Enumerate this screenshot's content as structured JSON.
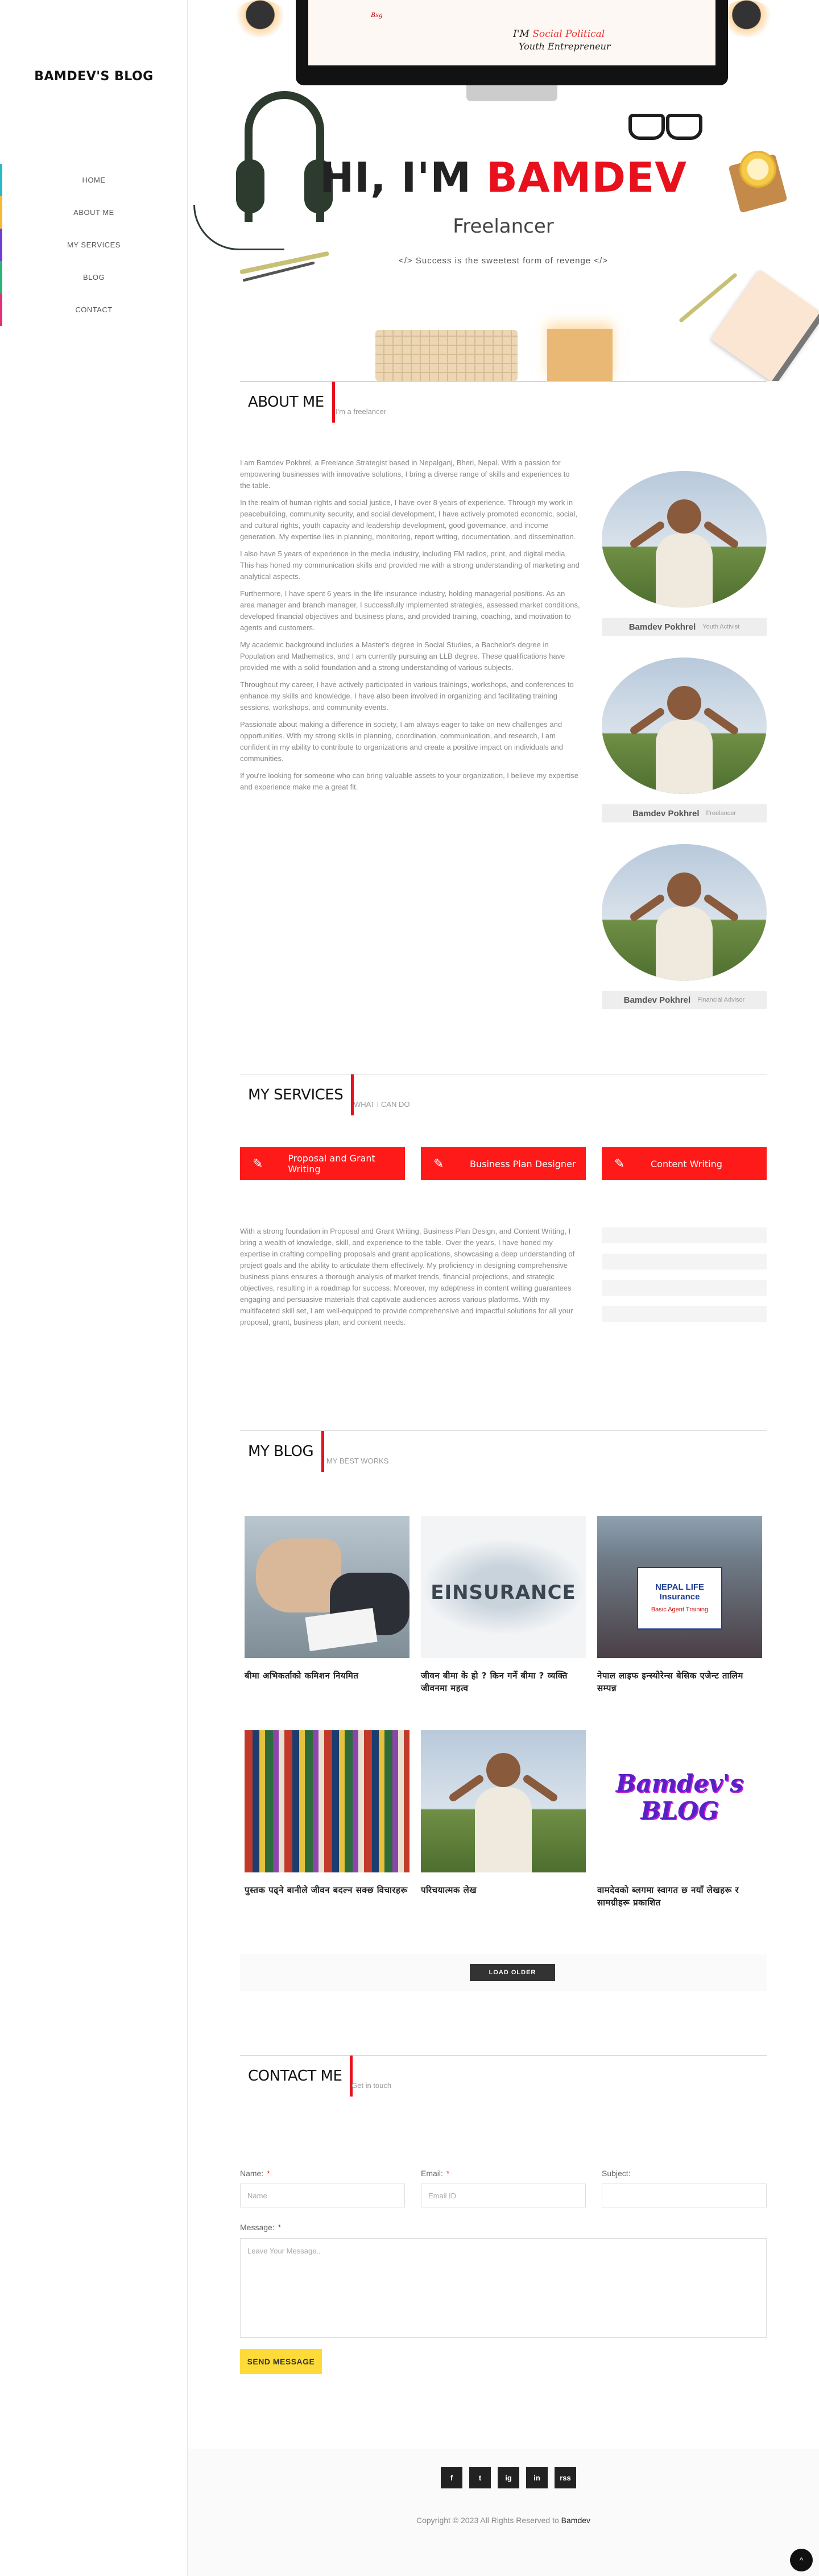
{
  "sidebar": {
    "brand": "BAMDEV'S BLOG",
    "items": [
      {
        "label": "HOME",
        "color": "#2bb7c6"
      },
      {
        "label": "ABOUT ME",
        "color": "#f6b935"
      },
      {
        "label": "MY SERVICES",
        "color": "#6b3fd6"
      },
      {
        "label": "BLOG",
        "color": "#2bb27b"
      },
      {
        "label": "CONTACT",
        "color": "#e0307a"
      }
    ]
  },
  "hero": {
    "screen_logo": "Bsg",
    "screen_line1_a": "I'M ",
    "screen_line1_b": "Social Political",
    "screen_line2": "Youth Entrepreneur",
    "title_prefix": "HI, I'M ",
    "title_name": "BAMDEV",
    "subtitle": "Freelancer",
    "quote": "</> Success is the sweetest form of revenge </>"
  },
  "about": {
    "title": "ABOUT ME",
    "sub": "I'm a freelancer",
    "paragraphs": [
      "I am Bamdev Pokhrel, a Freelance Strategist based in Nepalganj, Bheri, Nepal. With a passion for empowering businesses with innovative solutions, I bring a diverse range of skills and experiences to the table.",
      "In the realm of human rights and social justice, I have over 8 years of experience. Through my work in peacebuilding, community security, and social development, I have actively promoted economic, social, and cultural rights, youth capacity and leadership development, good governance, and income generation. My expertise lies in planning, monitoring, report writing, documentation, and dissemination.",
      "I also have 5 years of experience in the media industry, including FM radios, print, and digital media. This has honed my communication skills and provided me with a strong understanding of marketing and analytical aspects.",
      "Furthermore, I have spent 6 years in the life insurance industry, holding managerial positions. As an area manager and branch manager, I successfully implemented strategies, assessed market conditions, developed financial objectives and business plans, and provided training, coaching, and motivation to agents and customers.",
      "My academic background includes a Master's degree in Social Studies, a Bachelor's degree in Population and Mathematics, and I am currently pursuing an LLB degree. These qualifications have provided me with a solid foundation and a strong understanding of various subjects.",
      "Throughout my career, I have actively participated in various trainings, workshops, and conferences to enhance my skills and knowledge. I have also been involved in organizing and facilitating training sessions, workshops, and community events.",
      "Passionate about making a difference in society, I am always eager to take on new challenges and opportunities. With my strong skills in planning, coordination, communication, and research, I am confident in my ability to contribute to organizations and create a positive impact on individuals and communities.",
      "If you're looking for someone who can bring valuable assets to your organization, I believe my expertise and experience make me a great fit."
    ],
    "profiles": [
      {
        "name": "Bamdev Pokhrel",
        "role": "Youth Activist"
      },
      {
        "name": "Bamdev Pokhrel",
        "role": "Freelancer"
      },
      {
        "name": "Bamdev Pokhrel",
        "role": "Financial Advisor"
      }
    ]
  },
  "services": {
    "title": "MY SERVICES",
    "sub": "WHAT I CAN DO",
    "buttons": [
      "Proposal and Grant Writing",
      "Business Plan Designer",
      "Content Writing"
    ],
    "text": "With a strong foundation in Proposal and Grant Writing, Business Plan Design, and Content Writing, I bring a wealth of knowledge, skill, and experience to the table. Over the years, I have honed my expertise in crafting compelling proposals and grant applications, showcasing a deep understanding of project goals and the ability to articulate them effectively. My proficiency in designing comprehensive business plans ensures a thorough analysis of market trends, financial projections, and strategic objectives, resulting in a roadmap for success. Moreover, my adeptness in content writing guarantees engaging and persuasive materials that captivate audiences across various platforms. With my multifaceted skill set, I am well-equipped to provide comprehensive and impactful solutions for all your proposal, grant, business plan, and content needs."
  },
  "blog": {
    "title": "MY BLOG",
    "sub": "MY BEST WORKS",
    "posts": [
      {
        "title": "बीमा अभिकर्ताको कमिशन नियमित",
        "thumb": "handshake"
      },
      {
        "title": "जीवन बीमा के हो ? किन गर्ने बीमा ? व्यक्ति जीवनमा महत्व",
        "thumb": "insurance"
      },
      {
        "title": "नेपाल लाइफ इन्स्योरेन्स बेसिक एजेन्ट तालिम सम्पन्न",
        "thumb": "group"
      },
      {
        "title": "पुस्तक पढ्ने बानीले जीवन बदल्न सक्छ विचारहरू",
        "thumb": "books"
      },
      {
        "title": "परिचयात्मक लेख",
        "thumb": "portrait"
      },
      {
        "title": "वामदेवको ब्लगमा स्वागत छ नयाँ लेखहरू र सामग्रीहरू प्रकाशित",
        "thumb": "logo"
      }
    ],
    "insurance_word": "EINSURANCE",
    "banner_text": "NEPAL LIFE Insurance",
    "banner_sub": "Basic Agent Training",
    "logo_text": "Bamdev's BLOG",
    "load_label": "LOAD OLDER"
  },
  "contact": {
    "title": "CONTACT ME",
    "sub": "Get in touch",
    "name_label": "Name:",
    "name_placeholder": "Name",
    "email_label": "Email:",
    "email_placeholder": "Email ID",
    "subject_label": "Subject:",
    "message_label": "Message:",
    "message_placeholder": "Leave Your Message..",
    "send_label": "SEND MESSAGE"
  },
  "footer": {
    "socials": [
      "f",
      "t",
      "ig",
      "in",
      "rss"
    ],
    "copyright_prefix": "Copyright © 2023 All Rights Reserved to ",
    "copyright_name": "Bamdev",
    "to_top": "^"
  }
}
